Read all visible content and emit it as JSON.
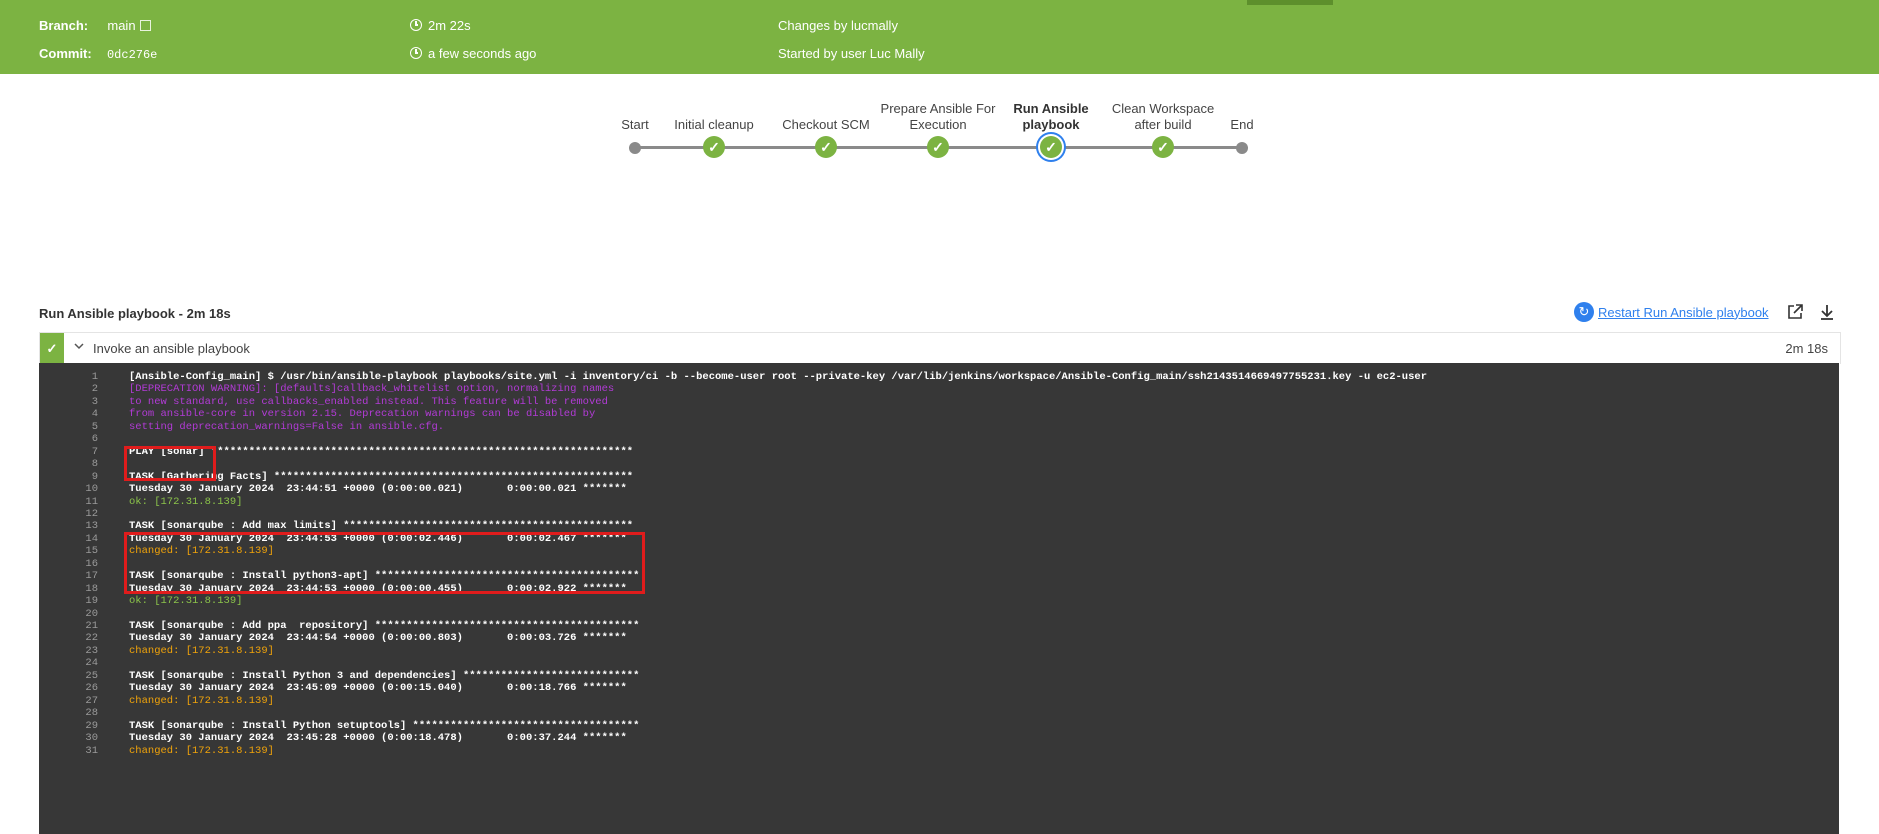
{
  "header": {
    "branch_label": "Branch:",
    "branch_value": "main",
    "commit_label": "Commit:",
    "commit_value": "0dc276e",
    "duration": "2m 22s",
    "time_ago": "a few seconds ago",
    "changes": "Changes by lucmally",
    "started": "Started by user Luc Mally"
  },
  "pipeline": {
    "stages": [
      {
        "label": "Start",
        "status": "start"
      },
      {
        "label": "Initial cleanup",
        "status": "success"
      },
      {
        "label": "Checkout SCM",
        "status": "success"
      },
      {
        "label": "Prepare Ansible For Execution",
        "status": "success"
      },
      {
        "label": "Run Ansible playbook",
        "status": "success-selected"
      },
      {
        "label": "Clean Workspace after build",
        "status": "success"
      },
      {
        "label": "End",
        "status": "end"
      }
    ],
    "success_color": "#7cb342",
    "selected_ring_color": "#2f80ed"
  },
  "stage_detail": {
    "title": "Run Ansible playbook - 2m 18s",
    "restart_label": "Restart Run Ansible playbook",
    "step_label": "Invoke an ansible playbook",
    "step_time": "2m 18s"
  },
  "icons": [
    "external-link-icon",
    "timer-icon",
    "clock-icon",
    "check-icon",
    "restart-icon",
    "open-external-icon",
    "download-icon",
    "chevron-down-icon"
  ],
  "console": {
    "lines": [
      {
        "n": "1",
        "text": "[Ansible-Config_main] $ /usr/bin/ansible-playbook playbooks/site.yml -i inventory/ci -b --become-user root --private-key /var/lib/jenkins/workspace/Ansible-Config_main/ssh2143514669497755231.key -u ec2-user",
        "kind": "cmd"
      },
      {
        "n": "2",
        "text": "[DEPRECATION WARNING]: [defaults]callback_whitelist option, normalizing names",
        "kind": "dep"
      },
      {
        "n": "3",
        "text": "to new standard, use callbacks_enabled instead. This feature will be removed",
        "kind": "dep"
      },
      {
        "n": "4",
        "text": "from ansible-core in version 2.15. Deprecation warnings can be disabled by",
        "kind": "dep"
      },
      {
        "n": "5",
        "text": "setting deprecation_warnings=False in ansible.cfg.",
        "kind": "dep"
      },
      {
        "n": "6",
        "text": "",
        "kind": "white"
      },
      {
        "n": "7",
        "text": "PLAY [sonar] *******************************************************************",
        "kind": "white"
      },
      {
        "n": "8",
        "text": "",
        "kind": "white"
      },
      {
        "n": "9",
        "text": "TASK [Gathering Facts] *********************************************************",
        "kind": "white"
      },
      {
        "n": "10",
        "text": "Tuesday 30 January 2024  23:44:51 +0000 (0:00:00.021)       0:00:00.021 *******",
        "kind": "white"
      },
      {
        "n": "11",
        "text": "ok: [172.31.8.139]",
        "kind": "ok"
      },
      {
        "n": "12",
        "text": "",
        "kind": "white"
      },
      {
        "n": "13",
        "text": "TASK [sonarqube : Add max limits] **********************************************",
        "kind": "white"
      },
      {
        "n": "14",
        "text": "Tuesday 30 January 2024  23:44:53 +0000 (0:00:02.446)       0:00:02.467 *******",
        "kind": "white"
      },
      {
        "n": "15",
        "text": "changed: [172.31.8.139]",
        "kind": "changed"
      },
      {
        "n": "16",
        "text": "",
        "kind": "white"
      },
      {
        "n": "17",
        "text": "TASK [sonarqube : Install python3-apt] ******************************************",
        "kind": "white"
      },
      {
        "n": "18",
        "text": "Tuesday 30 January 2024  23:44:53 +0000 (0:00:00.455)       0:00:02.922 *******",
        "kind": "white"
      },
      {
        "n": "19",
        "text": "ok: [172.31.8.139]",
        "kind": "ok"
      },
      {
        "n": "20",
        "text": "",
        "kind": "white"
      },
      {
        "n": "21",
        "text": "TASK [sonarqube : Add ppa  repository] ******************************************",
        "kind": "white"
      },
      {
        "n": "22",
        "text": "Tuesday 30 January 2024  23:44:54 +0000 (0:00:00.803)       0:00:03.726 *******",
        "kind": "white"
      },
      {
        "n": "23",
        "text": "changed: [172.31.8.139]",
        "kind": "changed"
      },
      {
        "n": "24",
        "text": "",
        "kind": "white"
      },
      {
        "n": "25",
        "text": "TASK [sonarqube : Install Python 3 and dependencies] ****************************",
        "kind": "white"
      },
      {
        "n": "26",
        "text": "Tuesday 30 January 2024  23:45:09 +0000 (0:00:15.040)       0:00:18.766 *******",
        "kind": "white"
      },
      {
        "n": "27",
        "text": "changed: [172.31.8.139]",
        "kind": "changed"
      },
      {
        "n": "28",
        "text": "",
        "kind": "white"
      },
      {
        "n": "29",
        "text": "TASK [sonarqube : Install Python setuptools] ************************************",
        "kind": "white"
      },
      {
        "n": "30",
        "text": "Tuesday 30 January 2024  23:45:28 +0000 (0:00:18.478)       0:00:37.244 *******",
        "kind": "white"
      },
      {
        "n": "31",
        "text": "changed: [172.31.8.139]",
        "kind": "changed"
      }
    ]
  }
}
